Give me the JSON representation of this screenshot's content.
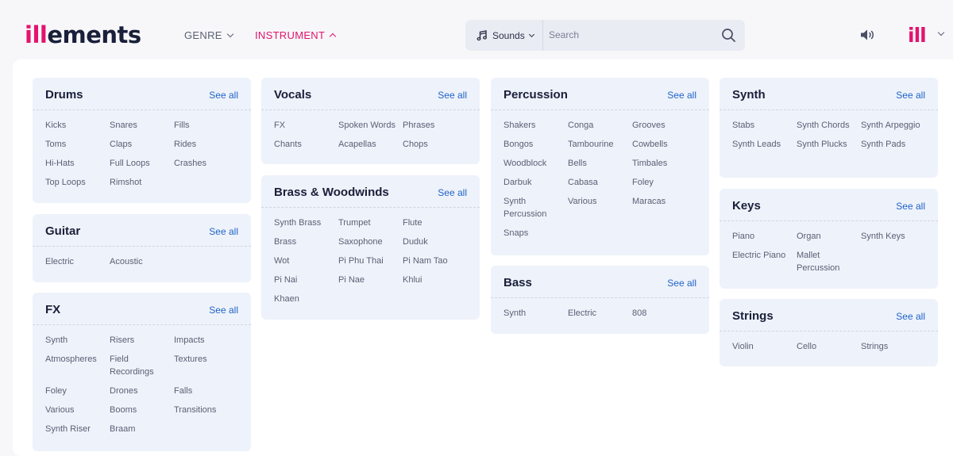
{
  "header": {
    "logo_prefix": "ill",
    "logo_suffix": "ements",
    "nav": [
      {
        "label": "GENRE"
      },
      {
        "label": "INSTRUMENT"
      }
    ],
    "search": {
      "category": "Sounds",
      "placeholder": "Search"
    },
    "user_logo": "ill"
  },
  "categories": [
    {
      "title": "Drums",
      "see_all": "See all",
      "items": [
        "Kicks",
        "Snares",
        "Fills",
        "Toms",
        "Claps",
        "Rides",
        "Hi-Hats",
        "Full Loops",
        "Crashes",
        "Top Loops",
        "Rimshot"
      ]
    },
    {
      "title": "Guitar",
      "see_all": "See all",
      "items": [
        "Electric",
        "Acoustic"
      ]
    },
    {
      "title": "FX",
      "see_all": "See all",
      "items": [
        "Synth",
        "Risers",
        "Impacts",
        "Atmospheres",
        "Field Recordings",
        "Textures",
        "Foley",
        "Drones",
        "Falls",
        "Various",
        "Booms",
        "Transitions",
        "Synth Riser",
        "Braam"
      ]
    },
    {
      "title": "Vocals",
      "see_all": "See all",
      "items": [
        "FX",
        "Spoken Words",
        "Phrases",
        "Chants",
        "Acapellas",
        "Chops"
      ]
    },
    {
      "title": "Brass & Woodwinds",
      "see_all": "See all",
      "items": [
        "Synth Brass",
        "Trumpet",
        "Flute",
        "Brass",
        "Saxophone",
        "Duduk",
        "Wot",
        "Pi Phu Thai",
        "Pi Nam Tao",
        "Pi Nai",
        "Pi Nae",
        "Khlui",
        "Khaen"
      ]
    },
    {
      "title": "Percussion",
      "see_all": "See all",
      "items": [
        "Shakers",
        "Conga",
        "Grooves",
        "Bongos",
        "Tambourine",
        "Cowbells",
        "Woodblock",
        "Bells",
        "Timbales",
        "Darbuk",
        "Cabasa",
        "Foley",
        "Synth Percussion",
        "Various",
        "Maracas",
        "Snaps"
      ]
    },
    {
      "title": "Bass",
      "see_all": "See all",
      "items": [
        "Synth",
        "Electric",
        "808"
      ]
    },
    {
      "title": "Synth",
      "see_all": "See all",
      "items": [
        "Stabs",
        "Synth Chords",
        "Synth Arpeggio",
        "Synth Leads",
        "Synth Plucks",
        "Synth Pads"
      ]
    },
    {
      "title": "Keys",
      "see_all": "See all",
      "items": [
        "Piano",
        "Organ",
        "Synth Keys",
        "Electric Piano",
        "Mallet Percussion"
      ]
    },
    {
      "title": "Strings",
      "see_all": "See all",
      "items": [
        "Violin",
        "Cello",
        "Strings"
      ]
    }
  ],
  "colors": {
    "accent": "#e3136e",
    "link": "#2065c9",
    "card_bg": "#eef2fa"
  },
  "icons": [
    "music-note-icon",
    "search-icon",
    "volume-icon",
    "chevron-down-icon",
    "chevron-up-icon"
  ]
}
